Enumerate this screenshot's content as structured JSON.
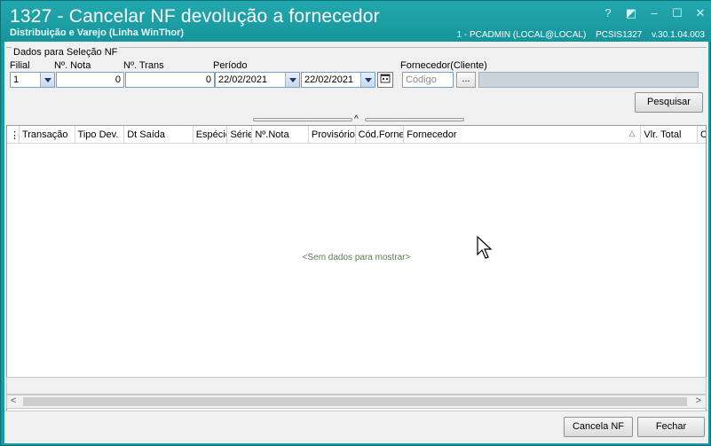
{
  "window": {
    "title": "1327 - Cancelar NF devolução a fornecedor",
    "subtitle": "Distribuição e Varejo (Linha WinThor)",
    "user_info": "1 - PCADMIN (LOCAL@LOCAL)",
    "routine_info": "PCSIS1327",
    "version": "v.30.1.04.003",
    "controls": {
      "help": "?",
      "restore": "◩",
      "minimize": "–",
      "maximize": "☐",
      "close": "✕"
    }
  },
  "filters": {
    "group_label": "Dados para Seleção NF",
    "filial": {
      "label": "Filial",
      "value": "1"
    },
    "nota": {
      "label": "Nº. Nota",
      "value": "0"
    },
    "trans": {
      "label": "Nº. Trans",
      "value": "0"
    },
    "periodo": {
      "label": "Período",
      "start": "22/02/2021",
      "end": "22/02/2021"
    },
    "fornecedor": {
      "label": "Fornecedor(Cliente)",
      "placeholder": "Código",
      "lookup_label": "..."
    }
  },
  "buttons": {
    "pesquisar": "Pesquisar",
    "cancela_nf": "Cancela NF",
    "fechar": "Fechar"
  },
  "grid": {
    "columns": [
      "Transação",
      "Tipo Dev.",
      "Dt Saída",
      "Espécie",
      "Série",
      "Nº.Nota",
      "Provisório",
      "Cód.Forne",
      "Fornecedor",
      "Vlr. Total",
      "C"
    ],
    "empty_message": "<Sem dados para mostrar>"
  },
  "icons": {
    "calendar": "calendar-icon",
    "column_chooser": "column-chooser-icon",
    "sort": "sort-asc-icon"
  }
}
